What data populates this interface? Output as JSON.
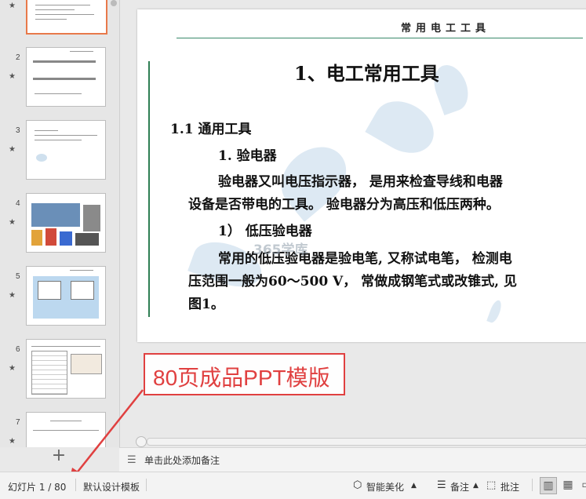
{
  "thumbnails": [
    {
      "number": "",
      "starred": true,
      "selected": true
    },
    {
      "number": "2",
      "starred": true,
      "selected": false
    },
    {
      "number": "3",
      "starred": true,
      "selected": false
    },
    {
      "number": "4",
      "starred": true,
      "selected": false
    },
    {
      "number": "5",
      "starred": true,
      "selected": false
    },
    {
      "number": "6",
      "starred": true,
      "selected": false
    },
    {
      "number": "7",
      "starred": true,
      "selected": false
    }
  ],
  "slide": {
    "header": "常用电工工具",
    "title": "1、电工常用工具",
    "section": "1.1 通用工具",
    "subsection": "1. 验电器",
    "para1_line1": "验电器又叫电压指示器， 是用来检查导线和电器",
    "para1_line2": "设备是否带电的工具。 验电器分为高压和低压两种。",
    "sub2": "1） 低压验电器",
    "para2_line1": "常用的低压验电器是验电笔, 又称试电笔， 检测电",
    "para2_line2": "压范围一般为60～500 V， 常做成钢笔式或改锥式, 见",
    "para2_line3": "图1。",
    "watermark": "365学库"
  },
  "callout": "80页成品PPT模版",
  "notes": {
    "placeholder": "单击此处添加备注"
  },
  "statusbar": {
    "slide_counter": "幻灯片 1 / 80",
    "template": "默认设计模板",
    "beautify": "智能美化",
    "notes": "备注",
    "comment": "批注"
  },
  "colors": {
    "accent_green": "#2f7f54",
    "callout_red": "#e04040",
    "selected_border": "#e8794a"
  }
}
